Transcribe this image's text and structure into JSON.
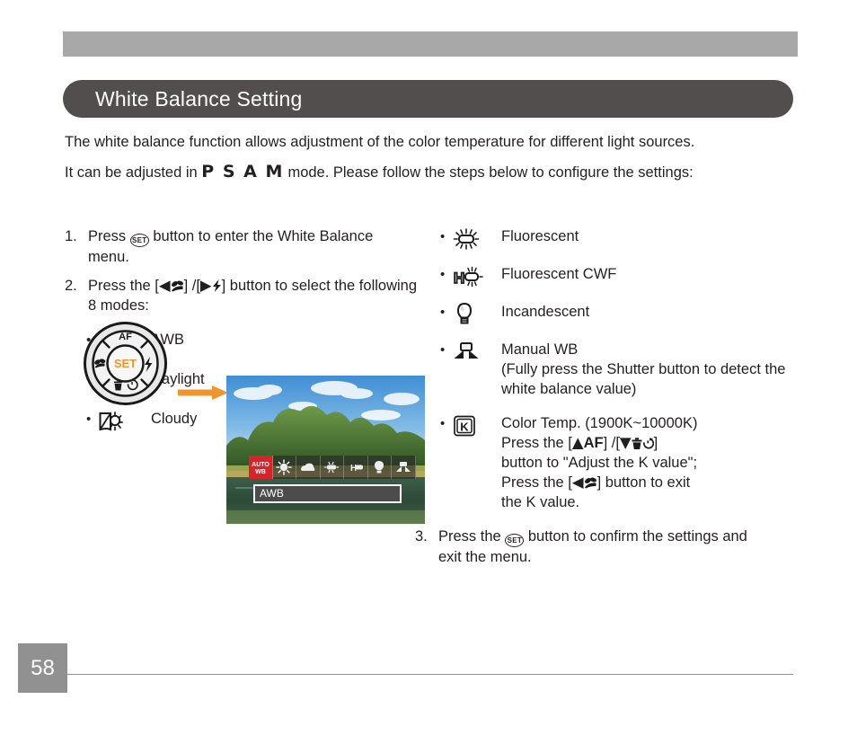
{
  "page": {
    "number": "58",
    "title": "White Balance Setting",
    "header_bar_color": "#a9a8a8",
    "title_bar_color": "#514e4d",
    "accent_color": "#f0942d",
    "selected_color": "#d7232a"
  },
  "intro": {
    "paragraph1": "The white balance function allows adjustment of the color temperature for different light sources.",
    "paragraph2_before": "It can be adjusted in ",
    "paragraph2_modes": "P S A M",
    "paragraph2_after": " mode. Please follow the steps below to configure the settings:"
  },
  "steps": {
    "step1": {
      "number": "1.",
      "text_before": "Press ",
      "button_label": "SET",
      "text_after": " button to enter the White Balance menu."
    },
    "step2": {
      "number": "2.",
      "text_before": "Press the [",
      "key_left": "◀",
      "key_left_icon": "macro-flower-icon",
      "text_mid": "] /[",
      "key_right": "▶",
      "key_right_icon": "flash-icon",
      "text_after": "] button to select the following 8 modes:"
    },
    "step3": {
      "number": "3.",
      "text_before": "Press the ",
      "button_label": "SET",
      "text_after": " button to confirm the settings and exit the menu."
    }
  },
  "dial": {
    "center_label": "SET",
    "top_label": "AF",
    "left_icon": "macro-flower-icon",
    "right_icon": "flash-icon",
    "bottom_left_icon": "trash-icon",
    "bottom_right_icon": "self-timer-icon"
  },
  "lcd": {
    "selected_mode_label": "AWB",
    "strip_icons": [
      "awb-icon",
      "daylight-icon",
      "cloudy-icon",
      "fluorescent-icon",
      "fluorescent-cwf-icon",
      "incandescent-icon",
      "manual-wb-icon"
    ]
  },
  "modes_left": [
    {
      "bullet": "•",
      "icon": "awb-icon",
      "label": "AWB"
    },
    {
      "bullet": "•",
      "icon": "daylight-icon",
      "label": "Daylight"
    },
    {
      "bullet": "•",
      "icon": "cloudy-icon",
      "label": "Cloudy"
    }
  ],
  "modes_right": [
    {
      "bullet": "•",
      "icon": "fluorescent-icon",
      "label": "Fluorescent"
    },
    {
      "bullet": "•",
      "icon": "fluorescent-cwf-icon",
      "label": "Fluorescent CWF"
    },
    {
      "bullet": "•",
      "icon": "incandescent-icon",
      "label": "Incandescent"
    },
    {
      "bullet": "•",
      "icon": "manual-wb-icon",
      "label": "Manual WB",
      "note": "(Fully press the Shutter button to detect the white balance value)"
    },
    {
      "bullet": "•",
      "icon": "color-temp-k-icon",
      "label": "Color Temp. (1900K~10000K)",
      "note_line1_before": "Press the [",
      "note_up": "▲",
      "note_up_label": "AF",
      "note_line1_mid": "] /[",
      "note_down": "▼",
      "note_line1_after": "]",
      "note_line2": "button to \"Adjust the K value\";",
      "note_line3_before": "Press the [",
      "note_left": "◀",
      "note_line3_after": "] button to exit",
      "note_line4": "the K value."
    }
  ]
}
